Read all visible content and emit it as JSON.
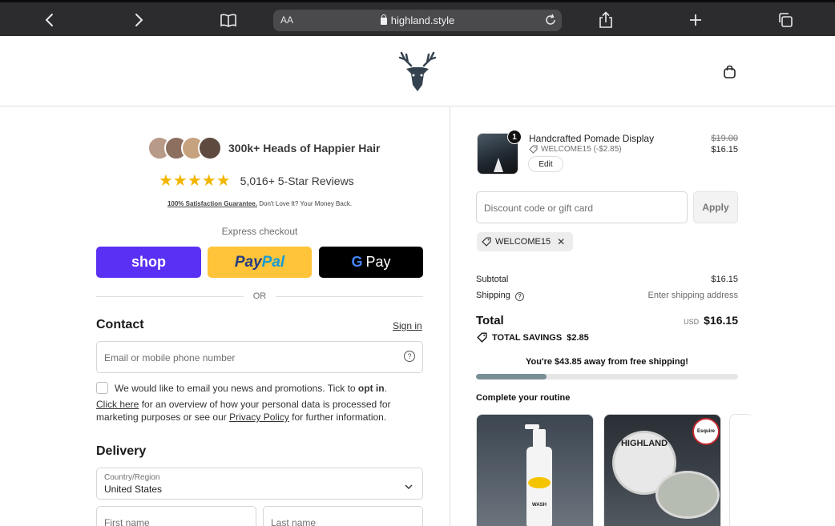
{
  "browser": {
    "text_size_label": "AA",
    "url": "highland.style"
  },
  "header": {
    "logo_icon": "stag-head-icon",
    "cart_icon": "shopping-bag-icon"
  },
  "social_proof": {
    "heads_text": "300k+ Heads of Happier Hair",
    "stars": "★★★★★",
    "reviews_text": "5,016+ 5-Star Reviews",
    "guarantee_bold": "100% Satisfaction Guarantee.",
    "guarantee_rest": " Don't Love It? Your Money Back."
  },
  "express": {
    "title": "Express checkout",
    "shop_label": "shop",
    "paypal_part1": "Pay",
    "paypal_part2": "Pal",
    "gpay_g": "G",
    "gpay_label": "Pay",
    "or_label": "OR"
  },
  "contact": {
    "title": "Contact",
    "signin_label": "Sign in",
    "email_placeholder": "Email or mobile phone number",
    "help_glyph": "?",
    "optin_text": "We would like to email you news and promotions. Tick to ",
    "optin_bold": "opt in",
    "optin_end": ".",
    "click_here": "Click here",
    "privacy_mid": " for an overview of how your personal data is processed for marketing purposes or see our ",
    "privacy_link": "Privacy Policy",
    "privacy_end": " for further information."
  },
  "delivery": {
    "title": "Delivery",
    "country_label": "Country/Region",
    "country_value": "United States",
    "first_name_placeholder": "First name",
    "last_name_placeholder": "Last name"
  },
  "order": {
    "item": {
      "quantity": "1",
      "name": "Handcrafted Pomade Display",
      "discount_code": "WELCOME15 (-$2.85)",
      "edit_label": "Edit",
      "price_old": "$19.00",
      "price_new": "$16.15"
    },
    "discount": {
      "placeholder": "Discount code or gift card",
      "apply_label": "Apply",
      "applied_code": "WELCOME15",
      "remove_glyph": "✕"
    },
    "summary": {
      "subtotal_label": "Subtotal",
      "subtotal_value": "$16.15",
      "shipping_label": "Shipping",
      "shipping_help": "?",
      "shipping_value": "Enter shipping address",
      "total_label": "Total",
      "total_currency": "USD",
      "total_value": "$16.15",
      "savings_label": "TOTAL SAVINGS",
      "savings_value": "$2.85"
    },
    "free_shipping": {
      "message": "You're $43.85 away from free shipping!",
      "progress_fraction": 0.27
    },
    "routine": {
      "title": "Complete your routine",
      "products": [
        {
          "label": "WASH"
        },
        {
          "brand": "HIGHLAND",
          "badge": "Esquire"
        }
      ]
    }
  },
  "colors": {
    "shop_purple": "#5a31f4",
    "paypal_yellow": "#ffc439",
    "star_gold": "#f2b600",
    "progress_fill": "#7a8e96"
  }
}
